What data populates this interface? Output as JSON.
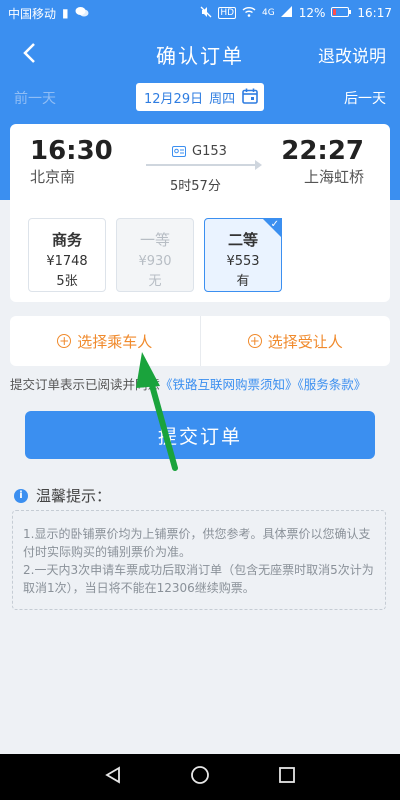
{
  "status_bar": {
    "carrier": "中国移动",
    "battery_pct": "12%",
    "time": "16:17",
    "network": "4G"
  },
  "nav": {
    "title": "确认订单",
    "right_link": "退改说明"
  },
  "date_bar": {
    "prev_day": "前一天",
    "date": "12月29日",
    "weekday": "周四",
    "next_day": "后一天"
  },
  "train": {
    "depart_time": "16:30",
    "depart_station": "北京南",
    "train_no": "G153",
    "duration": "5时57分",
    "arrive_time": "22:27",
    "arrive_station": "上海虹桥"
  },
  "seats": [
    {
      "name": "商务",
      "price": "¥1748",
      "count": "5张",
      "state": "available"
    },
    {
      "name": "一等",
      "price": "¥930",
      "count": "无",
      "state": "disabled"
    },
    {
      "name": "二等",
      "price": "¥553",
      "count": "有",
      "state": "selected"
    }
  ],
  "passengers": {
    "select_passenger": "选择乘车人",
    "select_transferee": "选择受让人"
  },
  "agreement": {
    "prefix": "提交订单表示已阅读并同意",
    "link1": "《铁路互联网购票须知》",
    "link2": "《服务条款》"
  },
  "submit_label": "提交订单",
  "tips": {
    "title": "温馨提示：",
    "line1": "1.显示的卧铺票价均为上铺票价，供您参考。具体票价以您确认支付时实际购买的铺别票价为准。",
    "line2": "2.一天内3次申请车票成功后取消订单（包含无座票时取消5次计为取消1次），当日将不能在12306继续购票。"
  },
  "colors": {
    "primary": "#3b8ff0",
    "accent_orange": "#f08a2c",
    "annotation_arrow": "#1aa33c"
  }
}
